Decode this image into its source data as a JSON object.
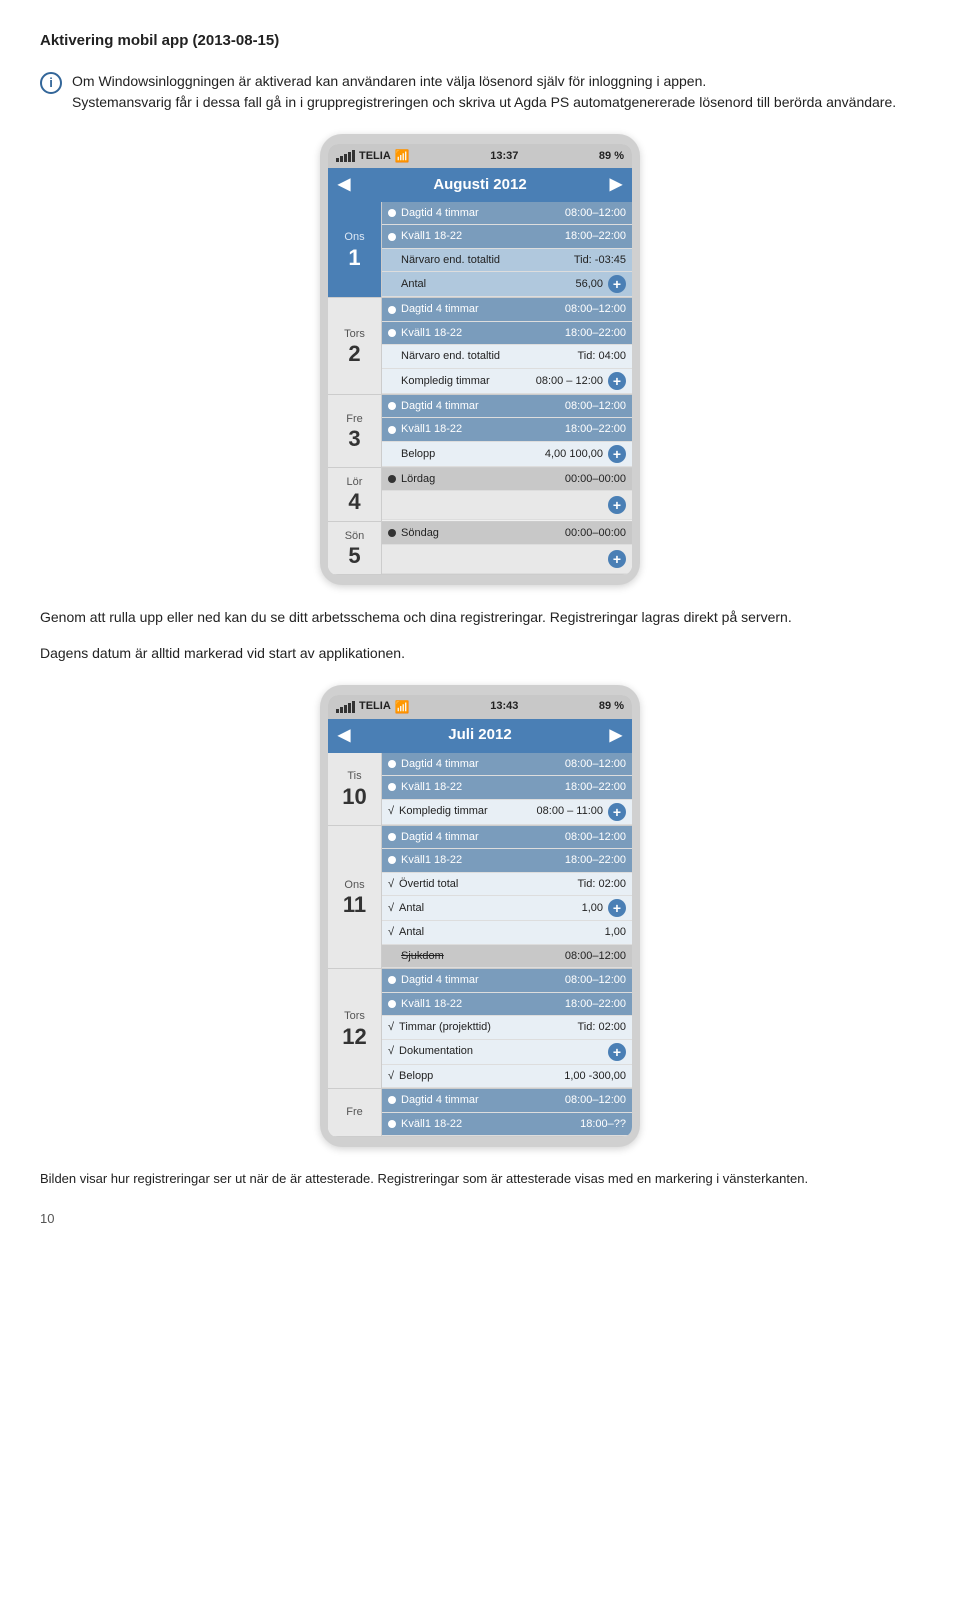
{
  "page": {
    "title": "Aktivering mobil app (2013-08-15)",
    "info_paragraph_1": "Om Windowsinloggningen är aktiverad kan användaren inte välja lösenord själv för inloggning i appen.",
    "info_paragraph_2": "Systemansvarig får i dessa fall gå in i gruppregistreringen och skriva ut Agda PS automatgenererade lösenord till berörda användare.",
    "body_text_1": "Genom att rulla upp eller ned kan du se ditt arbetsschema och dina registreringar. Registreringar lagras direkt på servern.",
    "body_text_2": "Dagens datum är alltid markerad vid start av applikationen.",
    "caption": "Bilden visar hur registreringar ser ut när de är attesterade. Registreringar som är attesterade visas med en markering i vänsterkanten.",
    "page_number": "10"
  },
  "phone1": {
    "status": {
      "signal": "TELIA",
      "wifi": "wifi",
      "time": "13:37",
      "battery": "89 %"
    },
    "month": "Augusti 2012",
    "days": [
      {
        "name": "Ons",
        "number": "1",
        "today": true,
        "rows": [
          {
            "type": "dark",
            "dot": true,
            "label": "Dagtid 4 timmar",
            "time": "08:00–12:00"
          },
          {
            "type": "dark",
            "dot": true,
            "label": "Kväll1 18-22",
            "time": "18:00–22:00"
          },
          {
            "type": "medium",
            "label": "Närvaro end. totaltid",
            "right": "Tid: -03:45"
          },
          {
            "type": "medium",
            "label": "Antal",
            "right": "56,00",
            "plus": true
          }
        ]
      },
      {
        "name": "Tors",
        "number": "2",
        "today": false,
        "rows": [
          {
            "type": "dark",
            "dot": true,
            "label": "Dagtid 4 timmar",
            "time": "08:00–12:00"
          },
          {
            "type": "dark",
            "dot": true,
            "label": "Kväll1 18-22",
            "time": "18:00–22:00"
          },
          {
            "type": "light",
            "label": "Närvaro end. totaltid",
            "right": "Tid: 04:00"
          },
          {
            "type": "light",
            "label": "Kompledig timmar",
            "right": "08:00 – 12:00",
            "plus": true
          }
        ]
      },
      {
        "name": "Fre",
        "number": "3",
        "today": false,
        "rows": [
          {
            "type": "dark",
            "dot": true,
            "label": "Dagtid 4 timmar",
            "time": "08:00–12:00"
          },
          {
            "type": "dark",
            "dot": true,
            "label": "Kväll1 18-22",
            "time": "18:00–22:00"
          },
          {
            "type": "light",
            "label": "Belopp",
            "right": "4,00  100,00",
            "plus": true
          }
        ]
      },
      {
        "name": "Lör",
        "number": "4",
        "today": false,
        "rows": [
          {
            "type": "grey",
            "dot": true,
            "label": "Lördag",
            "time": "00:00–00:00"
          },
          {
            "type": "empty",
            "plus": true
          }
        ]
      },
      {
        "name": "Sön",
        "number": "5",
        "today": false,
        "rows": [
          {
            "type": "grey",
            "dot": true,
            "label": "Söndag",
            "time": "00:00–00:00"
          },
          {
            "type": "empty",
            "plus": true
          }
        ]
      }
    ]
  },
  "phone2": {
    "status": {
      "signal": "TELIA",
      "wifi": "wifi",
      "time": "13:43",
      "battery": "89 %"
    },
    "month": "Juli 2012",
    "days": [
      {
        "name": "Tis",
        "number": "10",
        "today": false,
        "rows": [
          {
            "type": "dark",
            "dot": true,
            "label": "Dagtid 4 timmar",
            "time": "08:00–12:00"
          },
          {
            "type": "dark",
            "dot": true,
            "label": "Kväll1 18-22",
            "time": "18:00–22:00"
          },
          {
            "type": "light",
            "check": true,
            "label": "Kompledig timmar",
            "right": "08:00 – 11:00",
            "plus": true
          }
        ]
      },
      {
        "name": "Ons",
        "number": "11",
        "today": false,
        "rows": [
          {
            "type": "dark",
            "dot": true,
            "label": "Dagtid 4 timmar",
            "time": "08:00–12:00"
          },
          {
            "type": "dark",
            "dot": true,
            "label": "Kväll1 18-22",
            "time": "18:00–22:00"
          },
          {
            "type": "light",
            "check": true,
            "label": "Övertid total",
            "right": "Tid: 02:00"
          },
          {
            "type": "light",
            "check": true,
            "label": "Antal",
            "right": "1,00",
            "plus": true
          },
          {
            "type": "light",
            "check": true,
            "label": "Antal",
            "right": "1,00"
          },
          {
            "type": "grey",
            "strikethrough": true,
            "label": "Sjukdom",
            "time": "08:00–12:00"
          }
        ]
      },
      {
        "name": "Tors",
        "number": "12",
        "today": false,
        "rows": [
          {
            "type": "dark",
            "dot": true,
            "label": "Dagtid 4 timmar",
            "time": "08:00–12:00"
          },
          {
            "type": "dark",
            "dot": true,
            "label": "Kväll1 18-22",
            "time": "18:00–22:00"
          },
          {
            "type": "light",
            "check": true,
            "label": "Timmar (projekttid)",
            "right": "Tid: 02:00"
          },
          {
            "type": "light",
            "check": true,
            "label": "Dokumentation",
            "right": "",
            "plus": true
          },
          {
            "type": "light",
            "check": true,
            "label": "Belopp",
            "right": "1,00 -300,00"
          }
        ]
      },
      {
        "name": "Fre",
        "number": "",
        "today": false,
        "rows": [
          {
            "type": "dark",
            "dot": true,
            "label": "Dagtid 4 timmar",
            "time": "08:00–12:00"
          },
          {
            "type": "dark",
            "dot": true,
            "label": "Kväll1 18-22",
            "time": "18:00–??"
          }
        ]
      }
    ]
  }
}
